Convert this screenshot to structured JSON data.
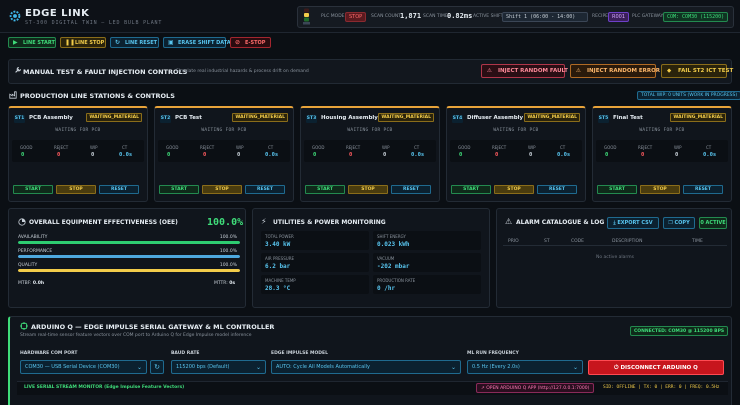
{
  "app": {
    "title": "EDGE LINK",
    "subtitle": "ST-300 DIGITAL TWIN — LED BULB PLANT"
  },
  "status": {
    "plc_mode_label": "PLC MODE",
    "plc_mode": "STOP",
    "scan_count_label": "SCAN COUNT",
    "scan_count": "1,871",
    "scan_time_label": "SCAN TIME",
    "scan_time": "0.82ms",
    "active_shift_label": "ACTIVE SHIFT",
    "active_shift": "Shift 1 (06:00 - 14:00)",
    "recipe_label": "RECIPE",
    "recipe": "R001",
    "plc_gateway_label": "PLC GATEWAY",
    "plc_gateway": "COM: COM30 (115200)"
  },
  "toolbar": {
    "line_start": "LINE START",
    "line_stop": "LINE STOP",
    "line_reset": "LINE RESET",
    "erase_shift": "ERASE SHIFT DATA",
    "estop": "E-STOP"
  },
  "manual": {
    "title": "MANUAL TEST & FAULT INJECTION CONTROLS",
    "subtitle": "Simulate real industrial hazards & process drift on demand",
    "inject_fault": "INJECT RANDOM FAULT",
    "inject_error": "INJECT RANDOM ERROR",
    "fail_st2": "FAIL ST2 ICT TEST"
  },
  "stations_section": {
    "title": "PRODUCTION LINE STATIONS & CONTROLS",
    "wip_total": "TOTAL WIP: 0 UNITS (WORK IN PROGRESS)"
  },
  "stations": [
    {
      "id": "ST1",
      "name": "PCB Assembly",
      "state": "WAITING_MATERIAL",
      "message": "WAITING FOR PCB",
      "good": "0",
      "reject": "0",
      "wip": "0",
      "ct": "0.0s"
    },
    {
      "id": "ST2",
      "name": "PCB Test",
      "state": "WAITING_MATERIAL",
      "message": "WAITING FOR PCB",
      "good": "0",
      "reject": "0",
      "wip": "0",
      "ct": "0.0s"
    },
    {
      "id": "ST3",
      "name": "Housing Assembly",
      "state": "WAITING_MATERIAL",
      "message": "WAITING FOR PCB",
      "good": "0",
      "reject": "0",
      "wip": "0",
      "ct": "0.0s"
    },
    {
      "id": "ST4",
      "name": "Diffuser Assembly",
      "state": "WAITING_MATERIAL",
      "message": "WAITING FOR PCB",
      "good": "0",
      "reject": "0",
      "wip": "0",
      "ct": "0.0s"
    },
    {
      "id": "ST5",
      "name": "Final Test",
      "state": "WAITING_MATERIAL",
      "message": "WAITING FOR PCB",
      "good": "0",
      "reject": "0",
      "wip": "0",
      "ct": "0.0s"
    }
  ],
  "station_labels": {
    "good": "GOOD",
    "reject": "REJECT",
    "wip": "WIP",
    "ct": "CT",
    "start": "START",
    "stop": "STOP",
    "reset": "RESET"
  },
  "oee": {
    "title": "OVERALL EQUIPMENT EFFECTIVENESS (OEE)",
    "value": "100.0%",
    "availability_label": "AVAILABILITY",
    "availability": "100.0%",
    "availability_fraction": 1.0,
    "performance_label": "PERFORMANCE",
    "performance": "100.0%",
    "performance_fraction": 1.0,
    "quality_label": "QUALITY",
    "quality": "100.0%",
    "quality_fraction": 1.0,
    "mtbf_label": "MTBF:",
    "mtbf": "0.0h",
    "mttr_label": "MTTR:",
    "mttr": "0s",
    "colors": {
      "availability": "#2ecc71",
      "performance": "#4ea8de",
      "quality": "#f2cc4a"
    }
  },
  "utilities": {
    "title": "UTILITIES & POWER MONITORING",
    "total_power_label": "TOTAL POWER",
    "total_power": "3.40 kW",
    "shift_energy_label": "SHIFT ENERGY",
    "shift_energy": "0.023 kWh",
    "air_pressure_label": "AIR PRESSURE",
    "air_pressure": "6.2 bar",
    "vacuum_label": "VACUUM",
    "vacuum": "-202 mbar",
    "machine_temp_label": "MACHINE TEMP",
    "machine_temp": "28.3 °C",
    "production_rate_label": "PRODUCTION RATE",
    "production_rate": "0 /hr"
  },
  "alarms": {
    "title": "ALARM CATALOGUE & LOG",
    "export_csv": "EXPORT CSV",
    "copy": "COPY",
    "active": "0 ACTIVE",
    "columns": [
      "PRIO",
      "ST",
      "CODE",
      "DESCRIPTION",
      "TIME"
    ],
    "empty": "No active alarms"
  },
  "arduino": {
    "title": "ARDUINO Q — EDGE IMPULSE SERIAL GATEWAY & ML CONTROLLER",
    "subtitle": "Stream real-time sensor feature vectors over COM port to Arduino Q for Edge Impulse model inference",
    "connection": "CONNECTED: COM30 @ 115200 BPS",
    "port_label": "HARDWARE COM PORT",
    "port_value": "COM30 — USB Serial Device (COM30)",
    "baud_label": "BAUD RATE",
    "baud_value": "115200 bps (Default)",
    "model_label": "EDGE IMPULSE MODEL",
    "model_value": "AUTO: Cycle All Models Automatically",
    "freq_label": "ML RUN FREQUENCY",
    "freq_value": "0.5 Hz (Every 2.0s)",
    "disconnect": "DISCONNECT ARDUINO Q",
    "serial_title": "LIVE SERIAL STREAM MONITOR (Edge Impulse Feature Vectors)",
    "open_app": "OPEN ARDUINO Q APP (http://127.0.0.1:7000)",
    "serial_stats": "SID: OFFLINE | TX: 0 | ERR: 0 | FREQ: 0.5Hz"
  }
}
